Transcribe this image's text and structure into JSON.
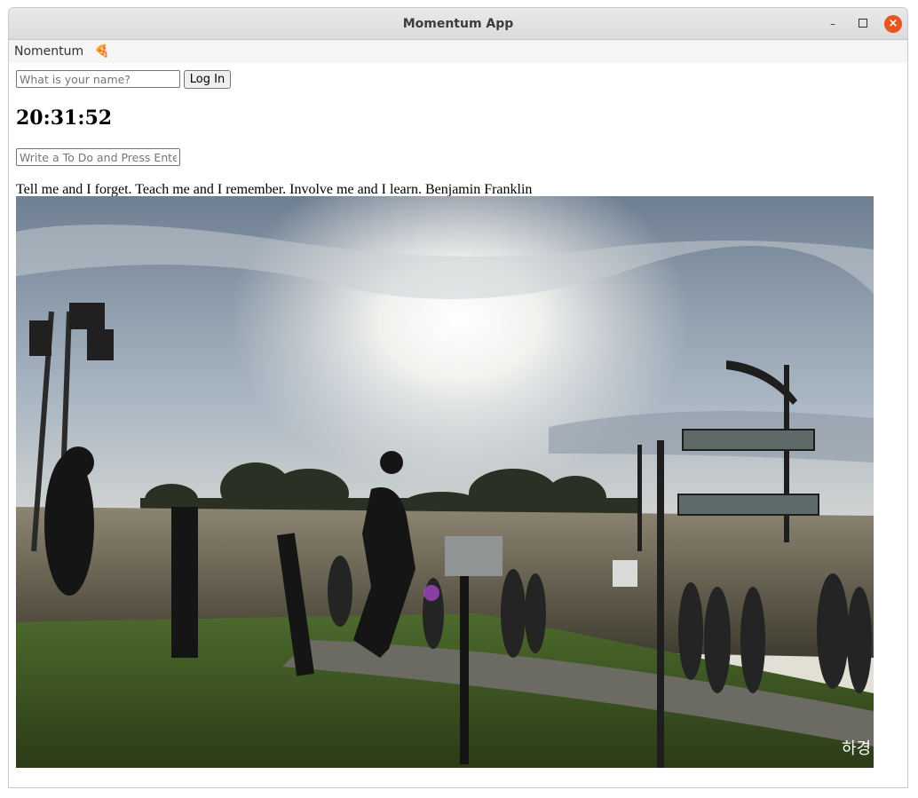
{
  "window": {
    "title": "Momentum App"
  },
  "menubar": {
    "brand": "Nomentum",
    "emoji": "🍕"
  },
  "login": {
    "name_placeholder": "What is your name?",
    "button_label": "Log In"
  },
  "clock": {
    "time": "20:31:52"
  },
  "todo": {
    "placeholder": "Write a To Do and Press Enter"
  },
  "quote": {
    "text": "Tell me and I forget. Teach me and I remember. Involve me and I learn.",
    "author": "Benjamin Franklin"
  },
  "background": {
    "watermark": "하경"
  },
  "colors": {
    "close_button": "#e95420",
    "titlebar": "#dcdcdc",
    "menubar": "#f5f5f5"
  }
}
